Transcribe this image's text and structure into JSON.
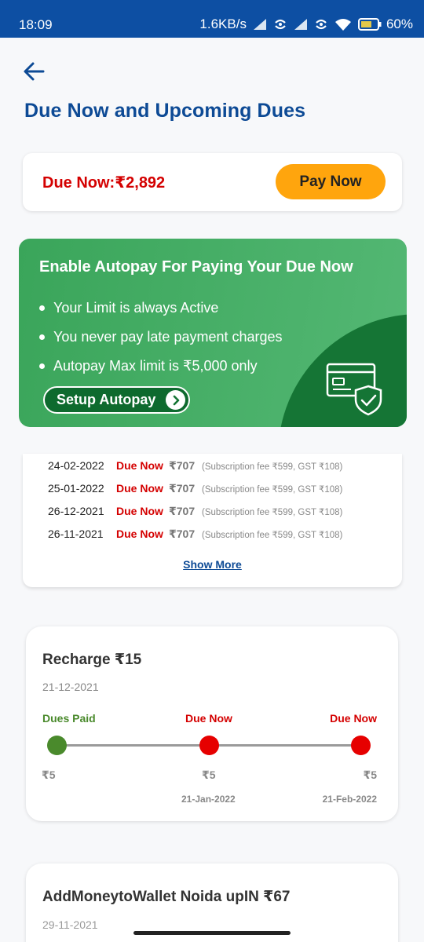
{
  "status_bar": {
    "time": "18:09",
    "speed": "1.6KB/s",
    "battery": "60%"
  },
  "header": {
    "title": "Due Now and Upcoming Dues"
  },
  "due_card": {
    "text": "Due Now:₹2,892",
    "pay_button": "Pay Now"
  },
  "autopay": {
    "title": "Enable Autopay For Paying Your Due Now",
    "points": [
      "Your Limit is always Active",
      "You never pay late payment charges",
      "Autopay Max limit is ₹5,000 only"
    ],
    "button": "Setup Autopay"
  },
  "history": {
    "rows": [
      {
        "date": "24-02-2022",
        "status": "Due Now",
        "amount": "₹707",
        "note": "(Subscription fee ₹599, GST ₹108)"
      },
      {
        "date": "25-01-2022",
        "status": "Due Now",
        "amount": "₹707",
        "note": "(Subscription fee ₹599, GST ₹108)"
      },
      {
        "date": "26-12-2021",
        "status": "Due Now",
        "amount": "₹707",
        "note": "(Subscription fee ₹599, GST ₹108)"
      },
      {
        "date": "26-11-2021",
        "status": "Due Now",
        "amount": "₹707",
        "note": "(Subscription fee ₹599, GST ₹108)"
      }
    ],
    "show_more": "Show More"
  },
  "recharge": {
    "title": "Recharge ₹15",
    "date": "21-12-2021",
    "steps": [
      {
        "status": "Dues Paid",
        "amount": "₹5",
        "date": ""
      },
      {
        "status": "Due Now",
        "amount": "₹5",
        "date": "21-Jan-2022"
      },
      {
        "status": "Due Now",
        "amount": "₹5",
        "date": "21-Feb-2022"
      }
    ]
  },
  "wallet": {
    "title": "AddMoneytoWallet Noida upIN ₹67",
    "date": "29-11-2021"
  },
  "colors": {
    "brand_blue": "#0d4a95",
    "due_red": "#d40000",
    "paid_green": "#4a8a2c",
    "pay_orange": "#ffa50d",
    "autopay_green": "#3aa55a"
  }
}
